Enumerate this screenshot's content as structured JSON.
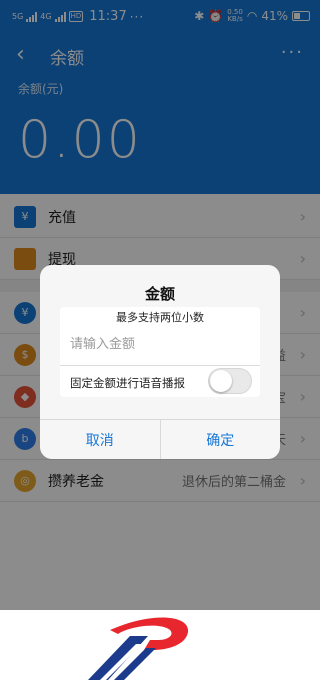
{
  "status_bar": {
    "time": "11:37",
    "signal_1": "5G",
    "signal_2": "4G",
    "hd": "HD",
    "dots": "···",
    "network_speed": "0.50\nKB/s",
    "battery": "41%"
  },
  "header": {
    "back_icon": "chevron-left-icon",
    "title": "余额",
    "more": "···",
    "balance_label": "余额(元)",
    "balance_value": "0.00"
  },
  "list": {
    "recharge_label": "充值",
    "withdraw_label": "提现",
    "pension_label": "攒养老金",
    "pension_right": "退休后的第二桶金",
    "partial_right_1": "益",
    "partial_right_2": "宝",
    "partial_right_3": "天"
  },
  "dialog": {
    "title": "金额",
    "hint": "最多支持两位小数",
    "input_placeholder": "请输入金额",
    "input_value": "",
    "voice_label": "固定金额进行语音播报",
    "voice_toggle_on": false,
    "cancel_label": "取消",
    "confirm_label": "确定"
  },
  "colors": {
    "primary": "#1677d8",
    "logo_red": "#e8262d",
    "logo_blue": "#1d3b8c"
  }
}
